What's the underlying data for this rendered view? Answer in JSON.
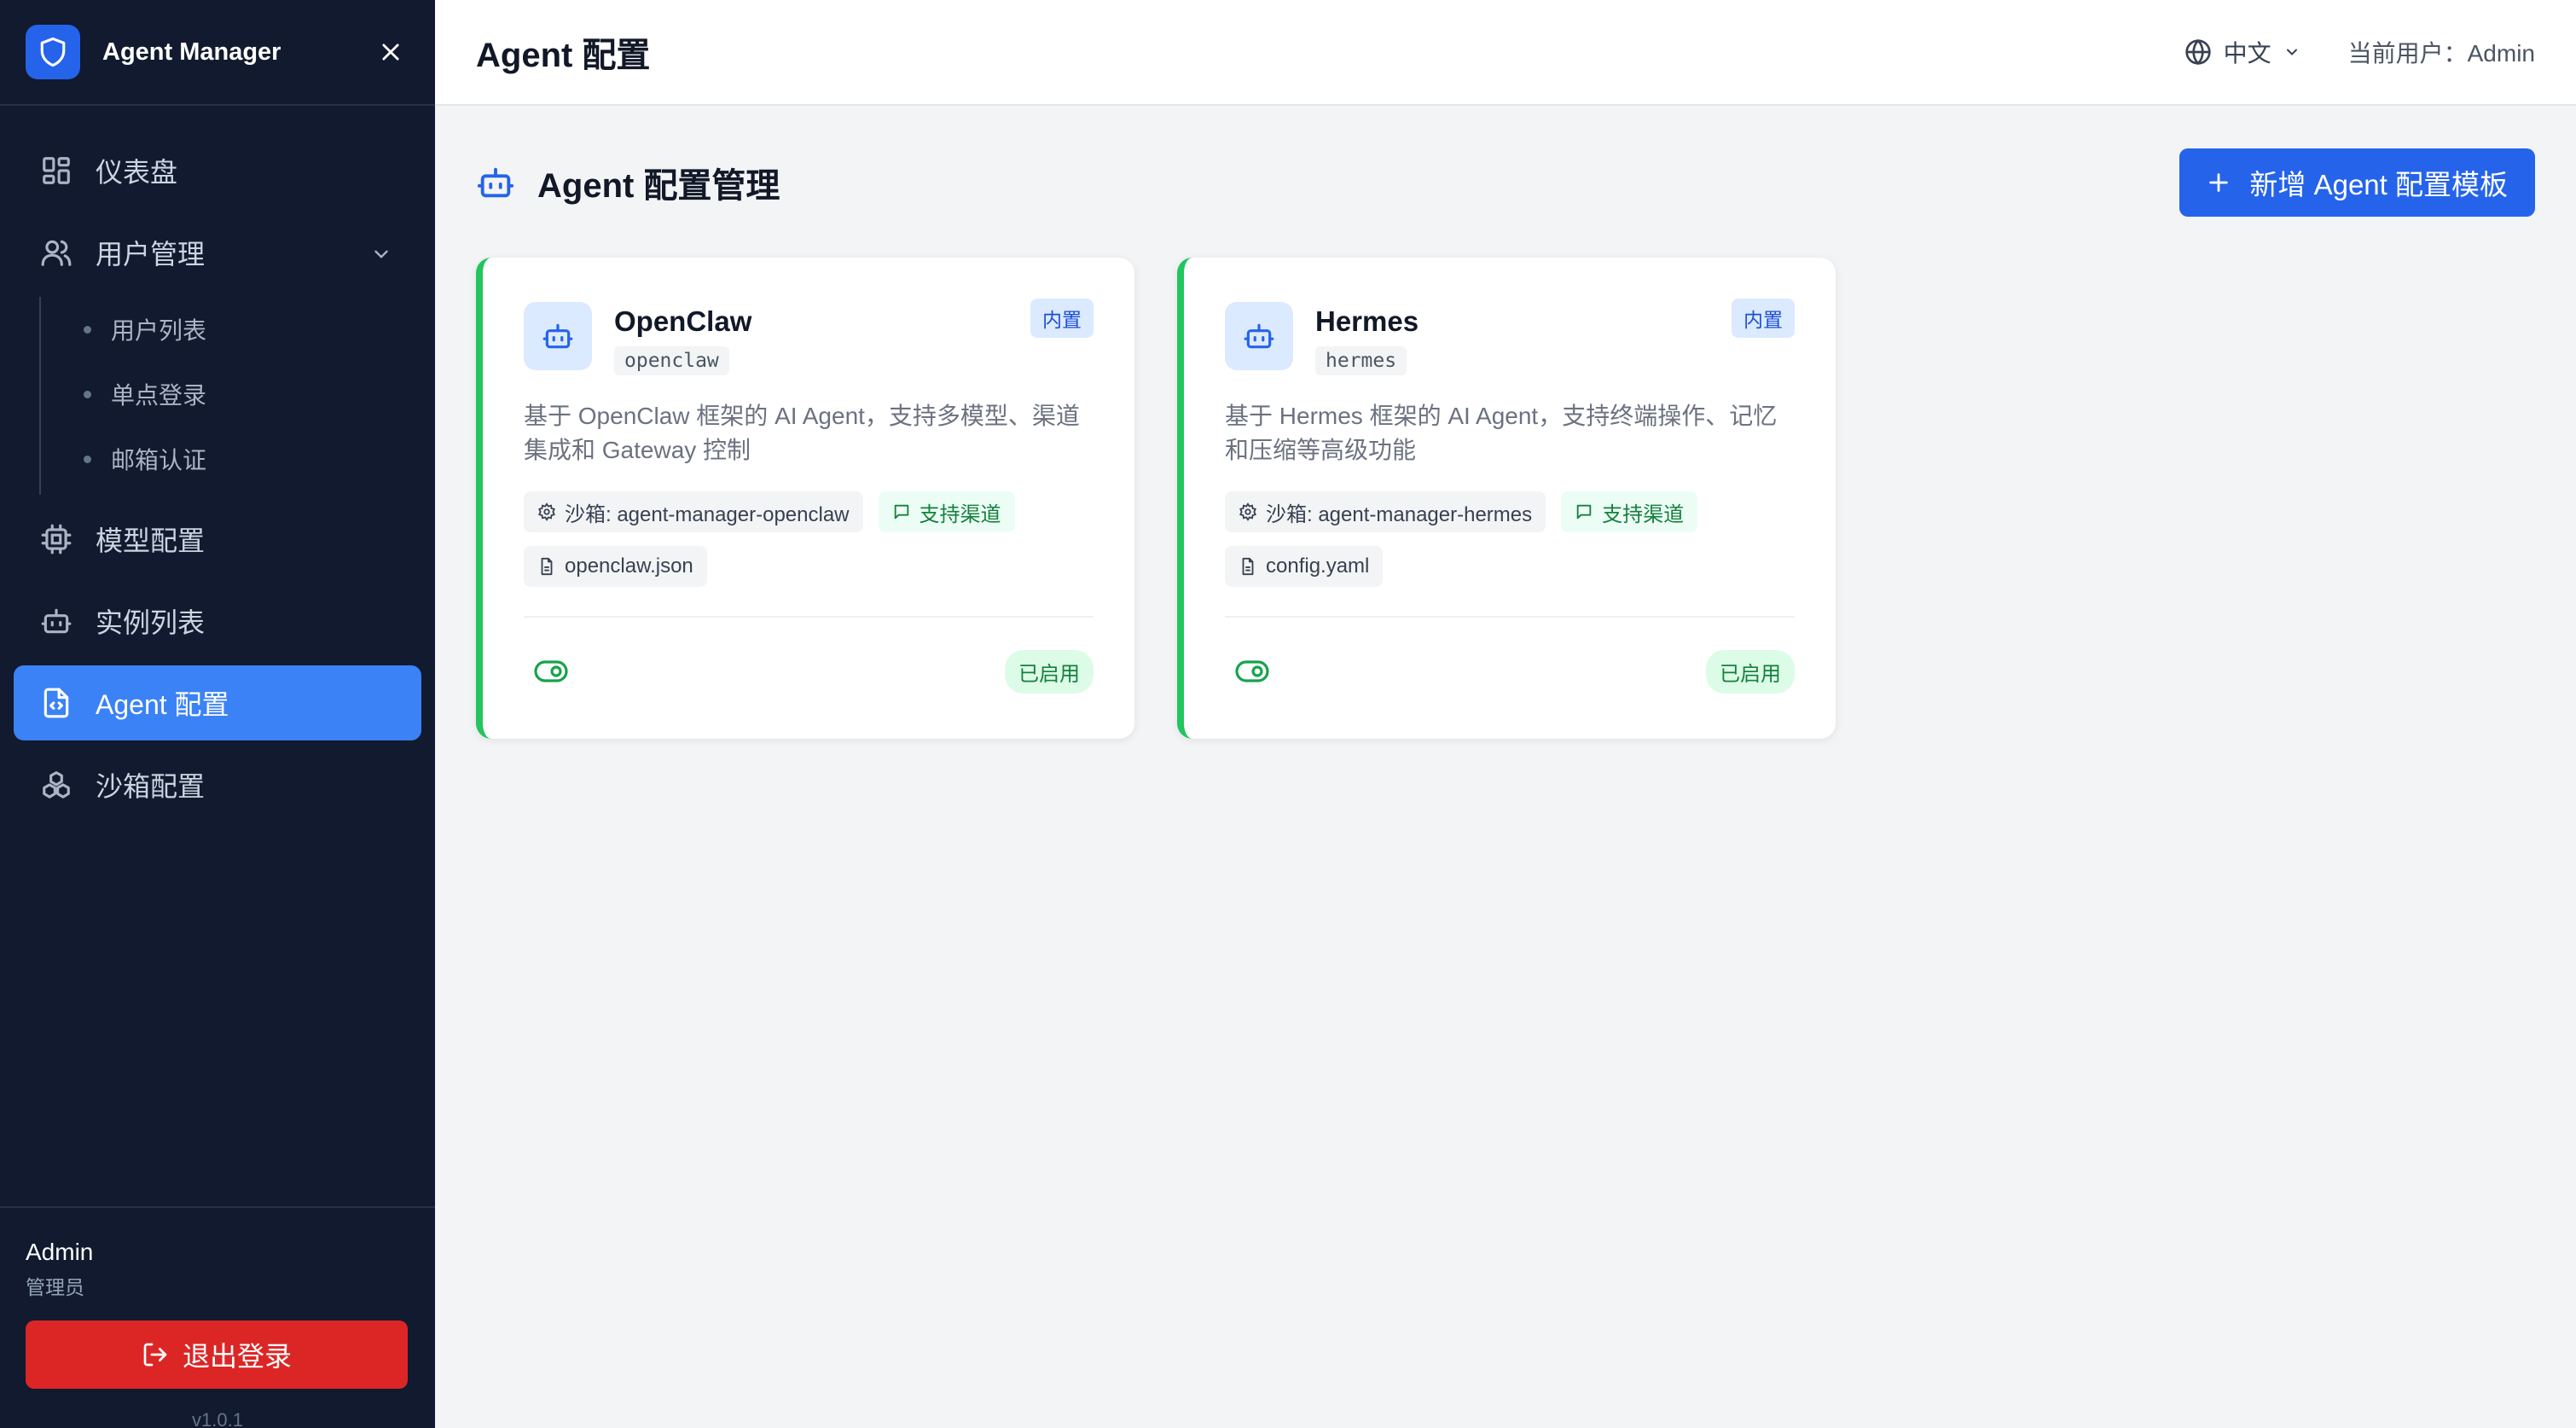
{
  "app": {
    "name": "Agent Manager",
    "version": "v1.0.1"
  },
  "sidebar": {
    "items": [
      {
        "label": "仪表盘",
        "icon": "dashboard-icon"
      },
      {
        "label": "用户管理",
        "icon": "users-icon",
        "expanded": true,
        "children": [
          {
            "label": "用户列表"
          },
          {
            "label": "单点登录"
          },
          {
            "label": "邮箱认证"
          }
        ]
      },
      {
        "label": "模型配置",
        "icon": "chip-icon"
      },
      {
        "label": "实例列表",
        "icon": "bot-icon"
      },
      {
        "label": "Agent 配置",
        "icon": "file-code-icon",
        "active": true
      },
      {
        "label": "沙箱配置",
        "icon": "boxes-icon"
      }
    ],
    "user": {
      "name": "Admin",
      "role": "管理员"
    },
    "logout_label": "退出登录"
  },
  "topbar": {
    "title": "Agent 配置",
    "language": "中文",
    "current_user": "当前用户：Admin"
  },
  "main": {
    "title": "Agent 配置管理",
    "add_button": "新增 Agent 配置模板",
    "cards": [
      {
        "name": "OpenClaw",
        "slug": "openclaw",
        "badge": "内置",
        "description": "基于 OpenClaw 框架的 AI Agent，支持多模型、渠道集成和 Gateway 控制",
        "sandbox": "沙箱: agent-manager-openclaw",
        "channel": "支持渠道",
        "config_file": "openclaw.json",
        "status": "已启用"
      },
      {
        "name": "Hermes",
        "slug": "hermes",
        "badge": "内置",
        "description": "基于 Hermes 框架的 AI Agent，支持终端操作、记忆和压缩等高级功能",
        "sandbox": "沙箱: agent-manager-hermes",
        "channel": "支持渠道",
        "config_file": "config.yaml",
        "status": "已启用"
      }
    ]
  },
  "colors": {
    "sidebar_bg": "#111a2e",
    "accent": "#2563eb",
    "active_nav": "#3b82f6",
    "danger": "#dc2626",
    "success": "#22c55e"
  }
}
